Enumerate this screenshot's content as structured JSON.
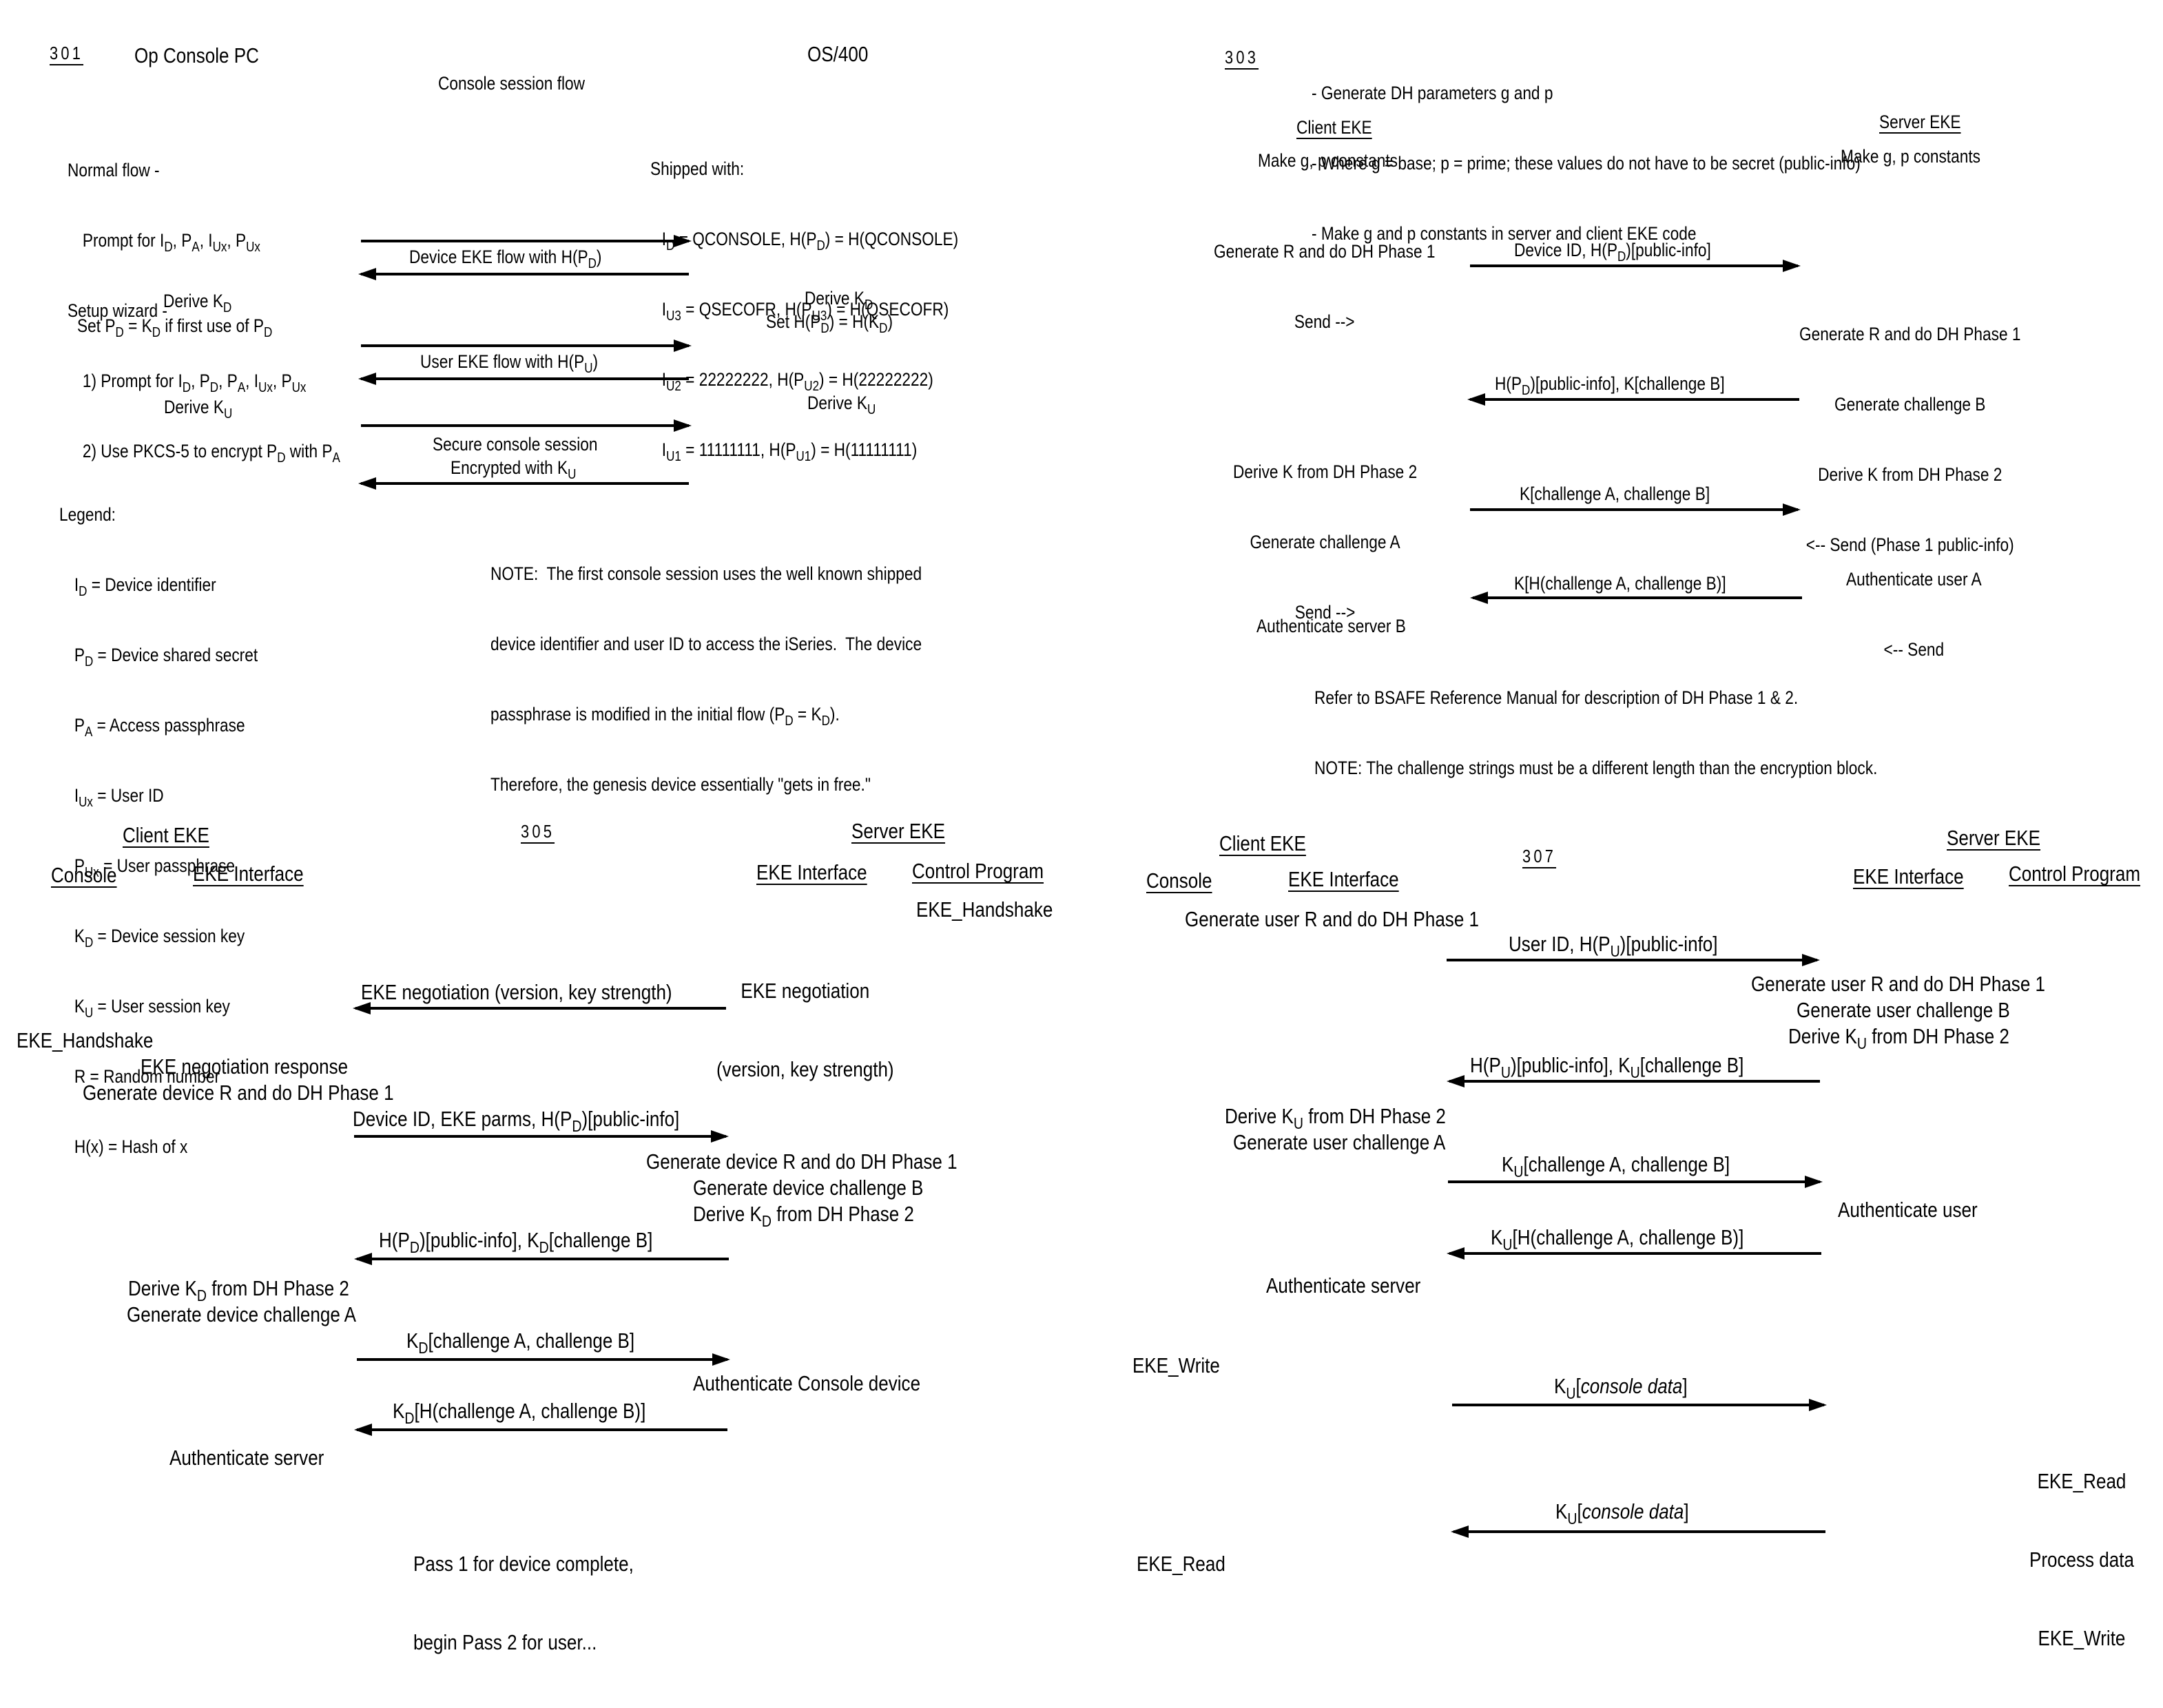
{
  "figure": {
    "panel_301": {
      "ref": "301",
      "client_title": "Op Console PC",
      "server_title": "OS/400",
      "subtitle": "Console session flow",
      "client_setup": [
        "Normal flow -",
        "Prompt for I_D, P_A, I_Ux, P_Ux",
        "Setup wizard -",
        "1) Prompt for I_D, P_D, P_A, I_Ux, P_Ux",
        "2) Use PKCS-5 to encrypt P_D with P_A"
      ],
      "shipped_with": {
        "heading": "Shipped with:",
        "lines": [
          "I_D = QCONSOLE, H(P_D) = H(QCONSOLE)",
          "I_U3 = QSECOFR, H(P_U3) = H(QSECOFR)",
          "I_U2 = 22222222, H(P_U2) = H(22222222)",
          "I_U1 = 11111111, H(P_U1) = H(11111111)"
        ]
      },
      "flows": [
        {
          "label": "Device EKE flow with H(P_D)",
          "direction": "both"
        },
        {
          "label": "User EKE flow with H(P_U)",
          "direction": "both"
        },
        {
          "label": "Secure console session\nEncrypted with K_U",
          "direction": "both"
        }
      ],
      "client_steps": [
        "Derive K_D",
        "Set P_D = K_D if first use of P_D",
        "Derive K_U"
      ],
      "server_steps": [
        "Derive K_D",
        "Set H(P_D) = H(K_D)",
        "Derive K_U"
      ],
      "legend": {
        "heading": "Legend:",
        "items": [
          "I_D = Device identifier",
          "P_D = Device shared secret",
          "P_A = Access passphrase",
          "I_Ux = User ID",
          "P_Ux = User passphrase",
          "K_D = Device session key",
          "K_U = User session key",
          "R = Random number",
          "H(x) = Hash of x"
        ]
      },
      "note": [
        "NOTE:  The first console session uses the well known shipped",
        "device identifier and user ID to access the iSeries.  The device",
        "passphrase is modified in the initial flow (P_D = K_D).",
        "Therefore, the genesis device essentially \"gets in free.\""
      ]
    },
    "panel_303": {
      "ref": "303",
      "notes": [
        "- Generate DH parameters g and p",
        "- Where g = base; p = prime; these values do not have to be secret (public-info)",
        "- Make g and p constants in server and client EKE code"
      ],
      "client_title": "Client EKE",
      "server_title": "Server EKE",
      "client_const": "Make g, p constants",
      "server_const": "Make g, p constants",
      "client_step1": [
        "Generate R and do DH Phase 1",
        "Send -->"
      ],
      "msg1": "Device ID, H(P_D)[public-info]",
      "server_step1": [
        "Generate R and do DH Phase 1",
        "Generate challenge B",
        "Derive K from DH Phase 2",
        "<-- Send (Phase 1 public-info)"
      ],
      "msg2": "H(P_D)[public-info], K[challenge B]",
      "client_step2": [
        "Derive K from DH Phase 2",
        "Generate challenge A",
        "Send -->"
      ],
      "msg3": "K[challenge A, challenge B]",
      "server_step2": [
        "Authenticate user A",
        "<-- Send"
      ],
      "msg4": "K[H(challenge A, challenge B)]",
      "client_step3": "Authenticate server B",
      "footer": [
        "Refer to BSAFE Reference Manual for description of DH Phase 1 & 2.",
        "NOTE: The challenge strings must be a different length than the encryption block."
      ]
    },
    "panel_305": {
      "ref": "305",
      "client_title": "Client EKE",
      "server_title": "Server EKE",
      "columns": [
        "Console",
        "EKE Interface",
        "EKE Interface",
        "Control Program"
      ],
      "server_handshake": "EKE_Handshake",
      "server_negotiation": [
        "EKE negotiation",
        "(version, key strength)"
      ],
      "msg1": "EKE negotiation (version, key strength)",
      "client_handshake": "EKE_Handshake",
      "client_response": "EKE negotiation response",
      "client_gen": "Generate device R and do DH Phase 1",
      "msg2": "Device ID, EKE parms, H(P_D)[public-info]",
      "server_steps": [
        "Generate device R and do DH Phase 1",
        "Generate device challenge B",
        "Derive K_D from DH Phase 2"
      ],
      "msg3": "H(P_D)[public-info], K_D[challenge B]",
      "client_steps": [
        "Derive K_D from DH Phase 2",
        "Generate device challenge A"
      ],
      "msg4": "K_D[challenge A, challenge B]",
      "server_auth": "Authenticate Console device",
      "msg5": "K_D[H(challenge A, challenge B)]",
      "client_auth": "Authenticate server",
      "pass_note": [
        "Pass 1 for device complete,",
        "begin Pass 2 for user..."
      ]
    },
    "panel_307": {
      "ref": "307",
      "client_title": "Client EKE",
      "server_title": "Server EKE",
      "columns": [
        "Console",
        "EKE Interface",
        "EKE Interface",
        "Control Program"
      ],
      "client_gen": "Generate user R and do DH Phase 1",
      "msg1": "User ID, H(P_U)[public-info]",
      "server_steps": [
        "Generate user R and do DH Phase 1",
        "Generate user challenge B",
        "Derive K_U from DH Phase 2"
      ],
      "msg2": "H(P_U)[public-info], K_U[challenge B]",
      "client_steps": [
        "Derive K_U from DH Phase 2",
        "Generate user challenge A"
      ],
      "msg3": "K_U[challenge A, challenge B]",
      "server_auth": "Authenticate user",
      "msg4": "K_U[H(challenge A, challenge B)]",
      "client_auth": "Authenticate server",
      "client_write": "EKE_Write",
      "msg5": "K_U[console data]",
      "server_process": [
        "EKE_Read",
        "Process data",
        "EKE_Write"
      ],
      "msg6": "K_U[console data]",
      "client_read": "EKE_Read"
    }
  }
}
